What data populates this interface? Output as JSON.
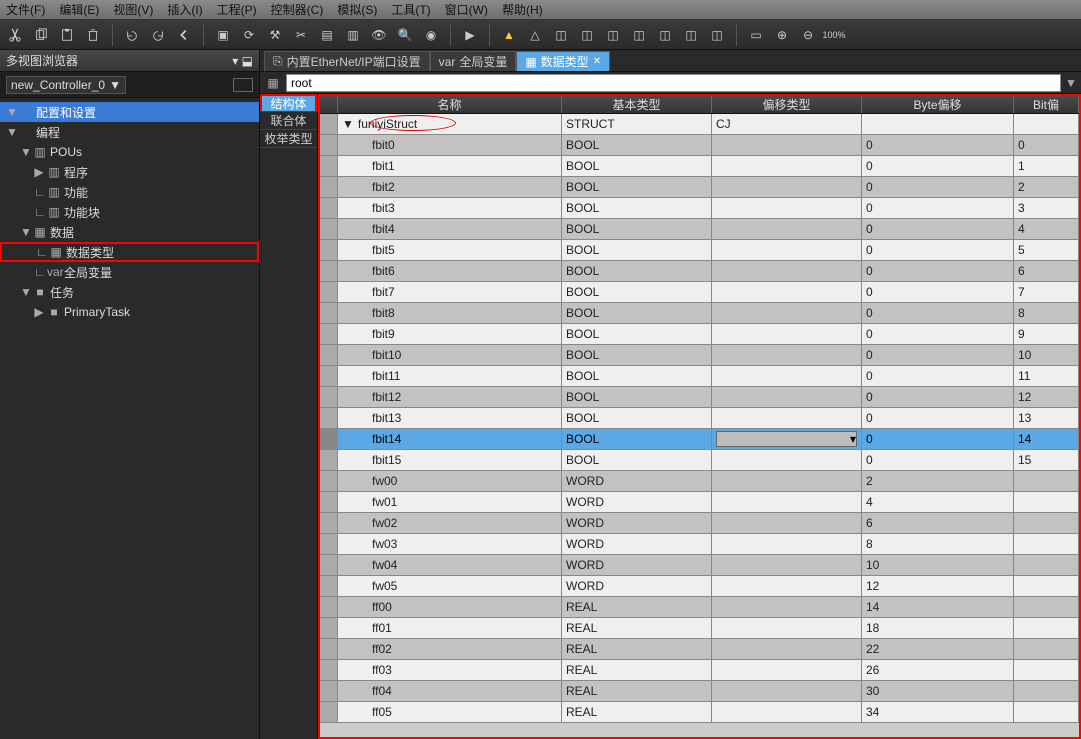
{
  "menu": [
    "文件(F)",
    "编辑(E)",
    "视图(V)",
    "插入(I)",
    "工程(P)",
    "控制器(C)",
    "模拟(S)",
    "工具(T)",
    "窗口(W)",
    "帮助(H)"
  ],
  "panel": {
    "title": "多视图浏览器",
    "combo": "new_Controller_0"
  },
  "tree": [
    {
      "indent": 0,
      "tw": "▼",
      "icon": "",
      "label": "配置和设置",
      "cls": "sel"
    },
    {
      "indent": 0,
      "tw": "▼",
      "icon": "",
      "label": "编程"
    },
    {
      "indent": 1,
      "tw": "▼",
      "icon": "▥",
      "label": "POUs"
    },
    {
      "indent": 2,
      "tw": "▶",
      "icon": "▥",
      "label": "程序"
    },
    {
      "indent": 2,
      "tw": "∟",
      "icon": "▥",
      "label": "功能"
    },
    {
      "indent": 2,
      "tw": "∟",
      "icon": "▥",
      "label": "功能块"
    },
    {
      "indent": 1,
      "tw": "▼",
      "icon": "▦",
      "label": "数据"
    },
    {
      "indent": 2,
      "tw": "∟",
      "icon": "▦",
      "label": "数据类型",
      "cls": "tree-hl-box"
    },
    {
      "indent": 2,
      "tw": "∟",
      "icon": "var",
      "label": "全局变量"
    },
    {
      "indent": 1,
      "tw": "▼",
      "icon": "■",
      "label": "任务"
    },
    {
      "indent": 2,
      "tw": "▶",
      "icon": "■",
      "label": "PrimaryTask"
    }
  ],
  "docTabs": [
    {
      "label": "内置EtherNet/IP端口设置",
      "icon": "⎘",
      "active": false
    },
    {
      "label": "全局变量",
      "icon": "var",
      "active": false
    },
    {
      "label": "数据类型",
      "icon": "▦",
      "active": true
    }
  ],
  "search": {
    "value": "root"
  },
  "catTabs": [
    "结构体",
    "联合体",
    "枚举类型"
  ],
  "catActive": 0,
  "gridCols": [
    "名称",
    "基本类型",
    "偏移类型",
    "Byte偏移",
    "Bit偏"
  ],
  "gridRows": [
    {
      "name": "funiyiStruct",
      "type": "STRUCT",
      "off": "CJ",
      "byte": "",
      "bit": "",
      "struct": true
    },
    {
      "name": "fbit0",
      "type": "BOOL",
      "off": "",
      "byte": "0",
      "bit": "0"
    },
    {
      "name": "fbit1",
      "type": "BOOL",
      "off": "",
      "byte": "0",
      "bit": "1"
    },
    {
      "name": "fbit2",
      "type": "BOOL",
      "off": "",
      "byte": "0",
      "bit": "2"
    },
    {
      "name": "fbit3",
      "type": "BOOL",
      "off": "",
      "byte": "0",
      "bit": "3"
    },
    {
      "name": "fbit4",
      "type": "BOOL",
      "off": "",
      "byte": "0",
      "bit": "4"
    },
    {
      "name": "fbit5",
      "type": "BOOL",
      "off": "",
      "byte": "0",
      "bit": "5"
    },
    {
      "name": "fbit6",
      "type": "BOOL",
      "off": "",
      "byte": "0",
      "bit": "6"
    },
    {
      "name": "fbit7",
      "type": "BOOL",
      "off": "",
      "byte": "0",
      "bit": "7"
    },
    {
      "name": "fbit8",
      "type": "BOOL",
      "off": "",
      "byte": "0",
      "bit": "8"
    },
    {
      "name": "fbit9",
      "type": "BOOL",
      "off": "",
      "byte": "0",
      "bit": "9"
    },
    {
      "name": "fbit10",
      "type": "BOOL",
      "off": "",
      "byte": "0",
      "bit": "10"
    },
    {
      "name": "fbit11",
      "type": "BOOL",
      "off": "",
      "byte": "0",
      "bit": "11"
    },
    {
      "name": "fbit12",
      "type": "BOOL",
      "off": "",
      "byte": "0",
      "bit": "12"
    },
    {
      "name": "fbit13",
      "type": "BOOL",
      "off": "",
      "byte": "0",
      "bit": "13"
    },
    {
      "name": "fbit14",
      "type": "BOOL",
      "off": "",
      "byte": "0",
      "bit": "14",
      "sel": true
    },
    {
      "name": "fbit15",
      "type": "BOOL",
      "off": "",
      "byte": "0",
      "bit": "15"
    },
    {
      "name": "fw00",
      "type": "WORD",
      "off": "",
      "byte": "2",
      "bit": ""
    },
    {
      "name": "fw01",
      "type": "WORD",
      "off": "",
      "byte": "4",
      "bit": ""
    },
    {
      "name": "fw02",
      "type": "WORD",
      "off": "",
      "byte": "6",
      "bit": ""
    },
    {
      "name": "fw03",
      "type": "WORD",
      "off": "",
      "byte": "8",
      "bit": ""
    },
    {
      "name": "fw04",
      "type": "WORD",
      "off": "",
      "byte": "10",
      "bit": ""
    },
    {
      "name": "fw05",
      "type": "WORD",
      "off": "",
      "byte": "12",
      "bit": ""
    },
    {
      "name": "ff00",
      "type": "REAL",
      "off": "",
      "byte": "14",
      "bit": ""
    },
    {
      "name": "ff01",
      "type": "REAL",
      "off": "",
      "byte": "18",
      "bit": ""
    },
    {
      "name": "ff02",
      "type": "REAL",
      "off": "",
      "byte": "22",
      "bit": ""
    },
    {
      "name": "ff03",
      "type": "REAL",
      "off": "",
      "byte": "26",
      "bit": ""
    },
    {
      "name": "ff04",
      "type": "REAL",
      "off": "",
      "byte": "30",
      "bit": ""
    },
    {
      "name": "ff05",
      "type": "REAL",
      "off": "",
      "byte": "34",
      "bit": ""
    }
  ]
}
